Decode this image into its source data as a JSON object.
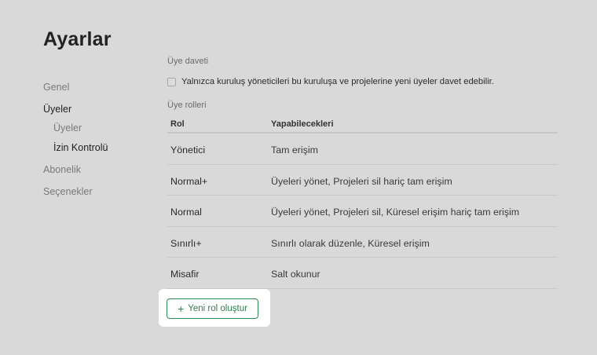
{
  "page": {
    "title": "Ayarlar"
  },
  "sidebar": {
    "items": [
      {
        "label": "Genel"
      },
      {
        "label": "Üyeler"
      },
      {
        "label": "Üyeler"
      },
      {
        "label": "İzin Kontrolü"
      },
      {
        "label": "Abonelik"
      },
      {
        "label": "Seçenekler"
      }
    ]
  },
  "invite": {
    "section_label": "Üye daveti",
    "checkbox_label": "Yalnızca kuruluş yöneticileri bu kuruluşa ve projelerine yeni üyeler davet edebilir.",
    "checked": false
  },
  "roles": {
    "section_label": "Üye rolleri",
    "columns": [
      "Rol",
      "Yapabilecekleri"
    ],
    "rows": [
      {
        "role": "Yönetici",
        "permissions": "Tam erişim"
      },
      {
        "role": "Normal+",
        "permissions": "Üyeleri yönet, Projeleri sil hariç tam erişim"
      },
      {
        "role": "Normal",
        "permissions": "Üyeleri yönet, Projeleri sil, Küresel erişim hariç tam erişim"
      },
      {
        "role": "Sınırlı+",
        "permissions": "Sınırlı olarak düzenle, Küresel erişim"
      },
      {
        "role": "Misafir",
        "permissions": "Salt okunur"
      }
    ],
    "new_role_button": "Yeni rol oluştur",
    "new_role_icon": "plus-icon"
  },
  "colors": {
    "background": "#d9d9d9",
    "accent": "#2e8b57"
  }
}
